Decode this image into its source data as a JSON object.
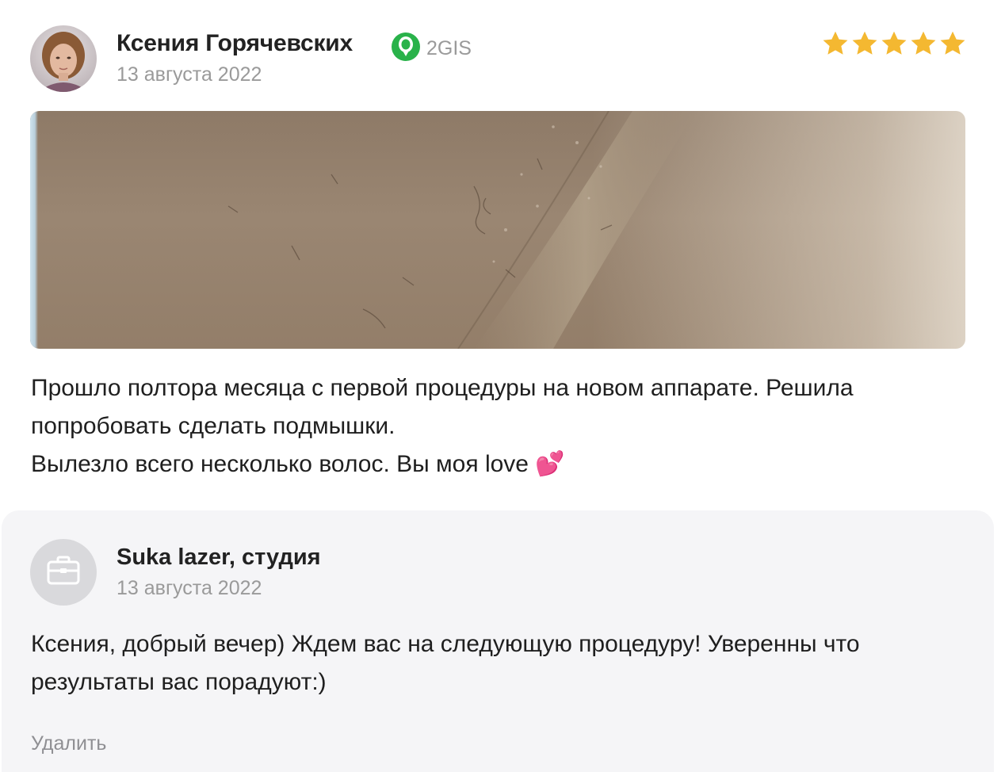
{
  "review": {
    "author_name": "Ксения Горячевских",
    "source": {
      "name": "2GIS",
      "icon": "2gis-logo-icon",
      "color": "#29b24a"
    },
    "date": "13 августа 2022",
    "rating": 5,
    "rating_max": 5,
    "star_color": "#f4b831",
    "text_lines": [
      "Прошло полтора месяца с первой процедуры на новом аппарате. Решила",
      "попробовать сделать подмышки.",
      "Вылезло всего несколько волос. Вы моя love 💕"
    ]
  },
  "reply": {
    "author_name": "Suka lazer, студия",
    "avatar_icon": "briefcase-icon",
    "date": "13 августа 2022",
    "text_lines": [
      "Ксения, добрый вечер) Ждем вас на следующую процедуру! Уверенны что",
      "результаты вас порадуют:)"
    ],
    "delete_label": "Удалить"
  }
}
